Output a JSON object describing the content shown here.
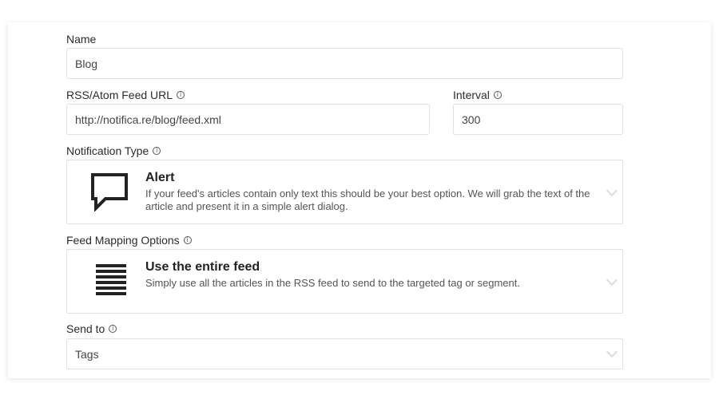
{
  "form": {
    "name": {
      "label": "Name",
      "value": "Blog"
    },
    "feed_url": {
      "label": "RSS/Atom Feed URL",
      "value": "http://notifica.re/blog/feed.xml",
      "info_icon": "info-icon"
    },
    "interval": {
      "label": "Interval",
      "value": "300",
      "info_icon": "info-icon"
    },
    "notification_type": {
      "label": "Notification Type",
      "selected": {
        "icon": "speech-bubble-icon",
        "title": "Alert",
        "description": "If your feed's articles contain only text this should be your best option. We will grab the text of the article and present it in a simple alert dialog."
      }
    },
    "feed_mapping": {
      "label": "Feed Mapping Options",
      "selected": {
        "icon": "list-lines-icon",
        "title": "Use the entire feed",
        "description": "Simply use all the articles in the RSS feed to send to the targeted tag or segment."
      }
    },
    "send_to": {
      "label": "Send to",
      "value": "Tags"
    }
  }
}
